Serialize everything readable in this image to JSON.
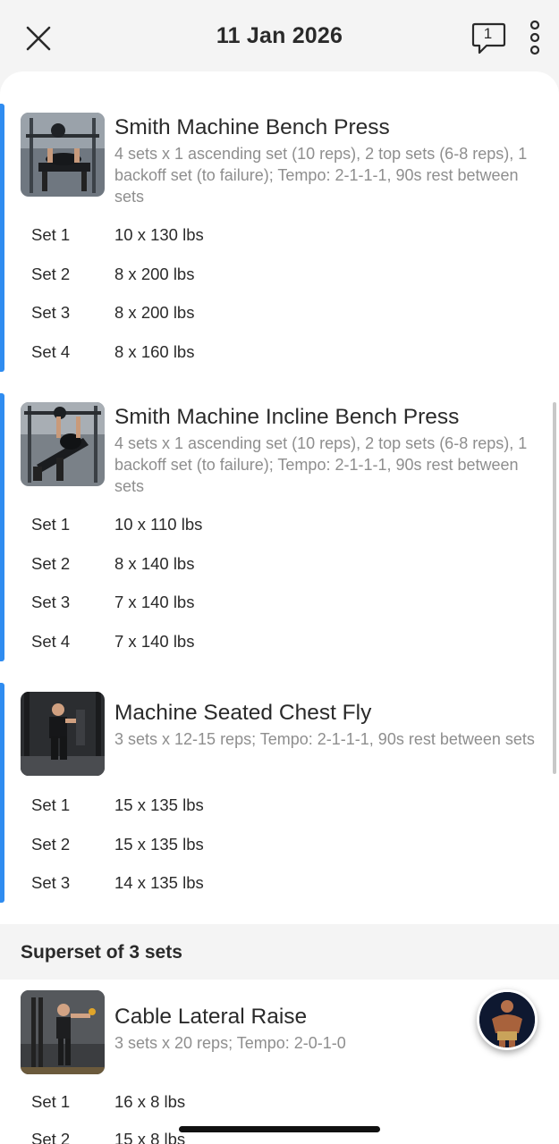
{
  "header": {
    "title": "11 Jan 2026",
    "comment_count": "1"
  },
  "exercises": [
    {
      "name": "Smith Machine Bench Press",
      "description": "4 sets x 1 ascending set (10 reps), 2 top sets (6-8 reps), 1 backoff set (to failure); Tempo: 2-1-1-1, 90s rest between sets",
      "sets": [
        {
          "label": "Set 1",
          "value": "10 x 130 lbs"
        },
        {
          "label": "Set 2",
          "value": "8 x 200 lbs"
        },
        {
          "label": "Set 3",
          "value": "8 x 200 lbs"
        },
        {
          "label": "Set 4",
          "value": "8 x 160 lbs"
        }
      ]
    },
    {
      "name": "Smith Machine Incline Bench Press",
      "description": "4 sets x 1 ascending set (10 reps), 2 top sets (6-8 reps), 1 backoff set (to failure); Tempo: 2-1-1-1, 90s rest between sets",
      "sets": [
        {
          "label": "Set 1",
          "value": "10 x 110 lbs"
        },
        {
          "label": "Set 2",
          "value": "8 x 140 lbs"
        },
        {
          "label": "Set 3",
          "value": "7 x 140 lbs"
        },
        {
          "label": "Set 4",
          "value": "7 x 140 lbs"
        }
      ]
    },
    {
      "name": "Machine Seated Chest Fly",
      "description": "3 sets x 12-15 reps; Tempo: 2-1-1-1, 90s rest between sets",
      "sets": [
        {
          "label": "Set 1",
          "value": "15 x 135 lbs"
        },
        {
          "label": "Set 2",
          "value": "15 x 135 lbs"
        },
        {
          "label": "Set 3",
          "value": "14 x 135 lbs"
        }
      ]
    }
  ],
  "superset": {
    "title": "Superset of 3 sets",
    "exercises": [
      {
        "name": "Cable Lateral Raise",
        "description": "3 sets x 20 reps; Tempo: 2-0-1-0",
        "sets": [
          {
            "label": "Set 1",
            "value": "16 x 8 lbs"
          },
          {
            "label": "Set 2",
            "value": "15 x 8 lbs"
          }
        ]
      }
    ]
  },
  "colors": {
    "accent": "#2f8cf0",
    "text": "#2a2a2a",
    "muted": "#8e8e8e",
    "background": "#f4f4f4"
  },
  "icons": [
    "close-icon",
    "comment-icon",
    "more-vertical-icon"
  ]
}
